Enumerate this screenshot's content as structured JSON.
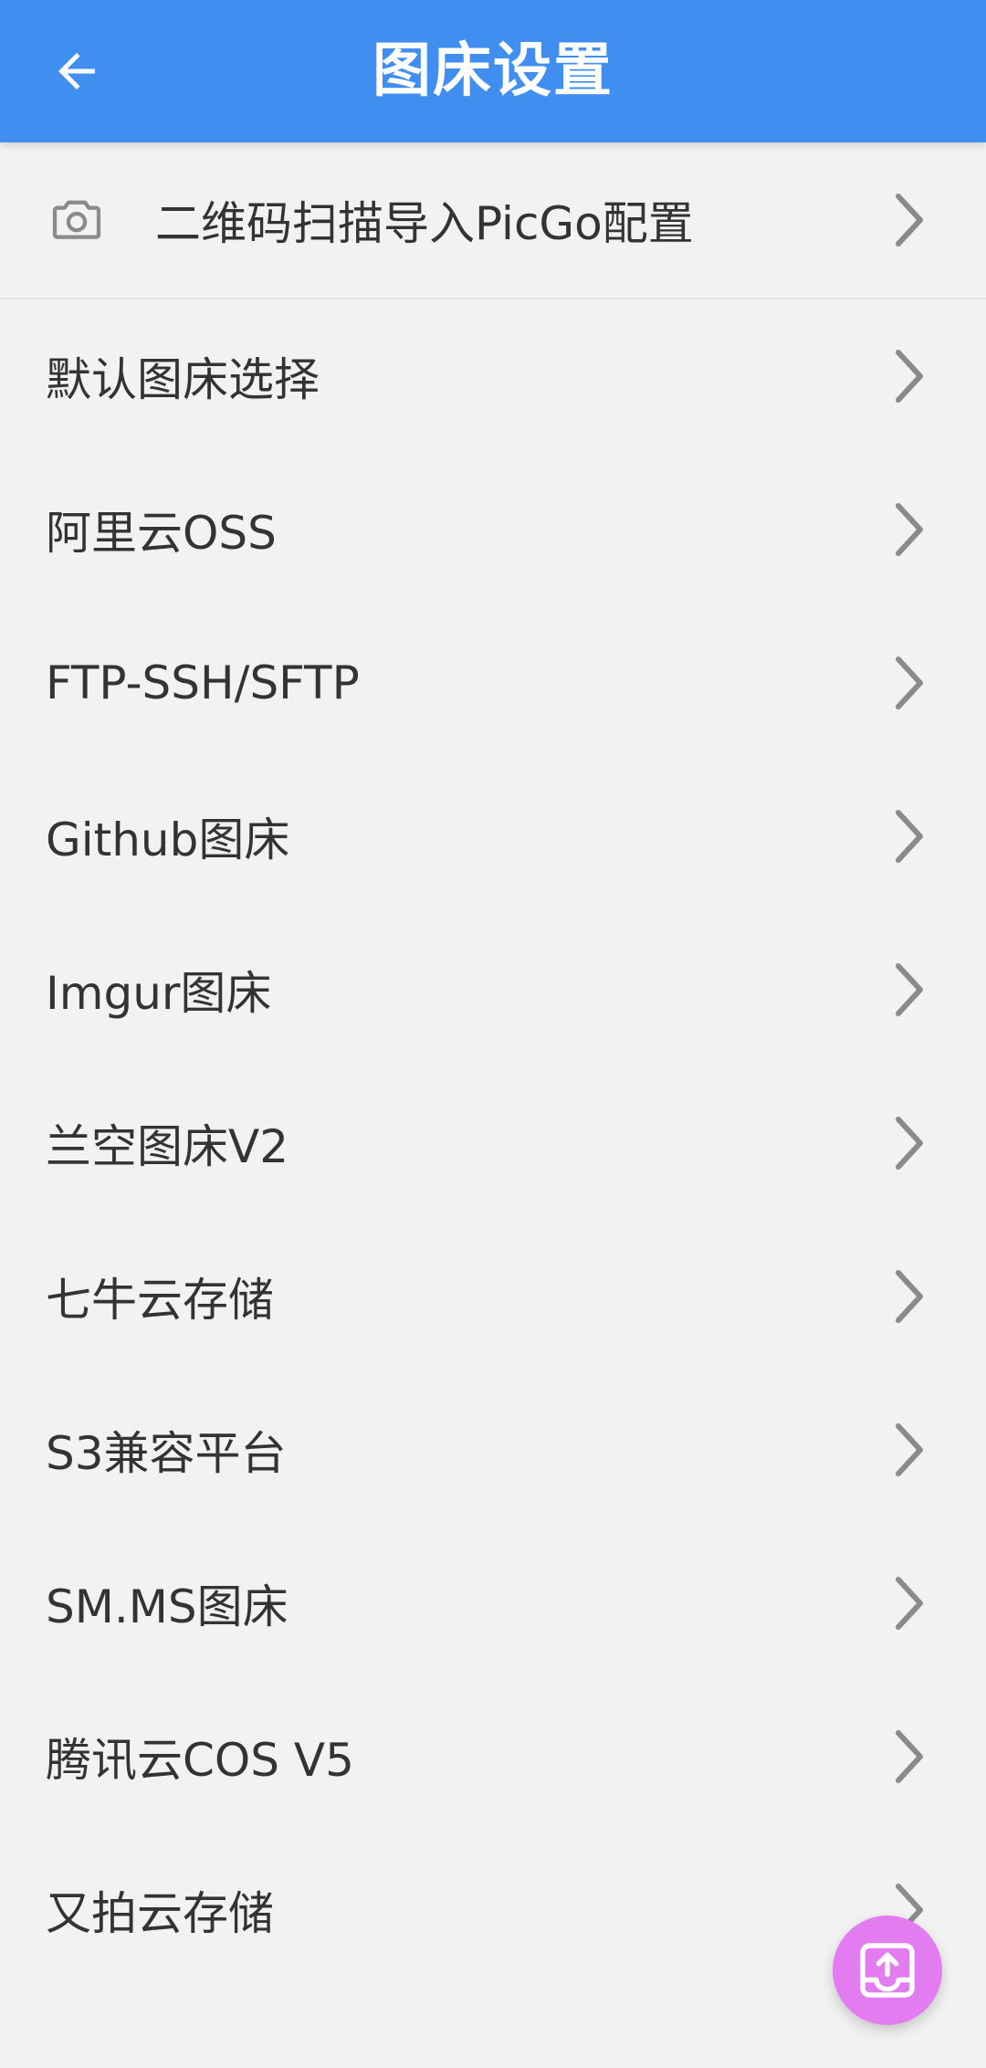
{
  "header": {
    "title": "图床设置",
    "back_icon": "arrow-left-icon"
  },
  "colors": {
    "appbar": "#3f8ef0",
    "background": "#f2f2f2",
    "fab": "#e27cf0",
    "text": "#333333",
    "chevron": "#8a8a8a"
  },
  "qr_row": {
    "icon": "camera-icon",
    "label": "二维码扫描导入PicGo配置"
  },
  "items": [
    {
      "label": "默认图床选择"
    },
    {
      "label": "阿里云OSS"
    },
    {
      "label": "FTP-SSH/SFTP"
    },
    {
      "label": "Github图床"
    },
    {
      "label": "Imgur图床"
    },
    {
      "label": "兰空图床V2"
    },
    {
      "label": "七牛云存储"
    },
    {
      "label": "S3兼容平台"
    },
    {
      "label": "SM.MS图床"
    },
    {
      "label": "腾讯云COS V5"
    },
    {
      "label": "又拍云存储"
    }
  ],
  "fab": {
    "icon": "upload-tray-icon"
  }
}
